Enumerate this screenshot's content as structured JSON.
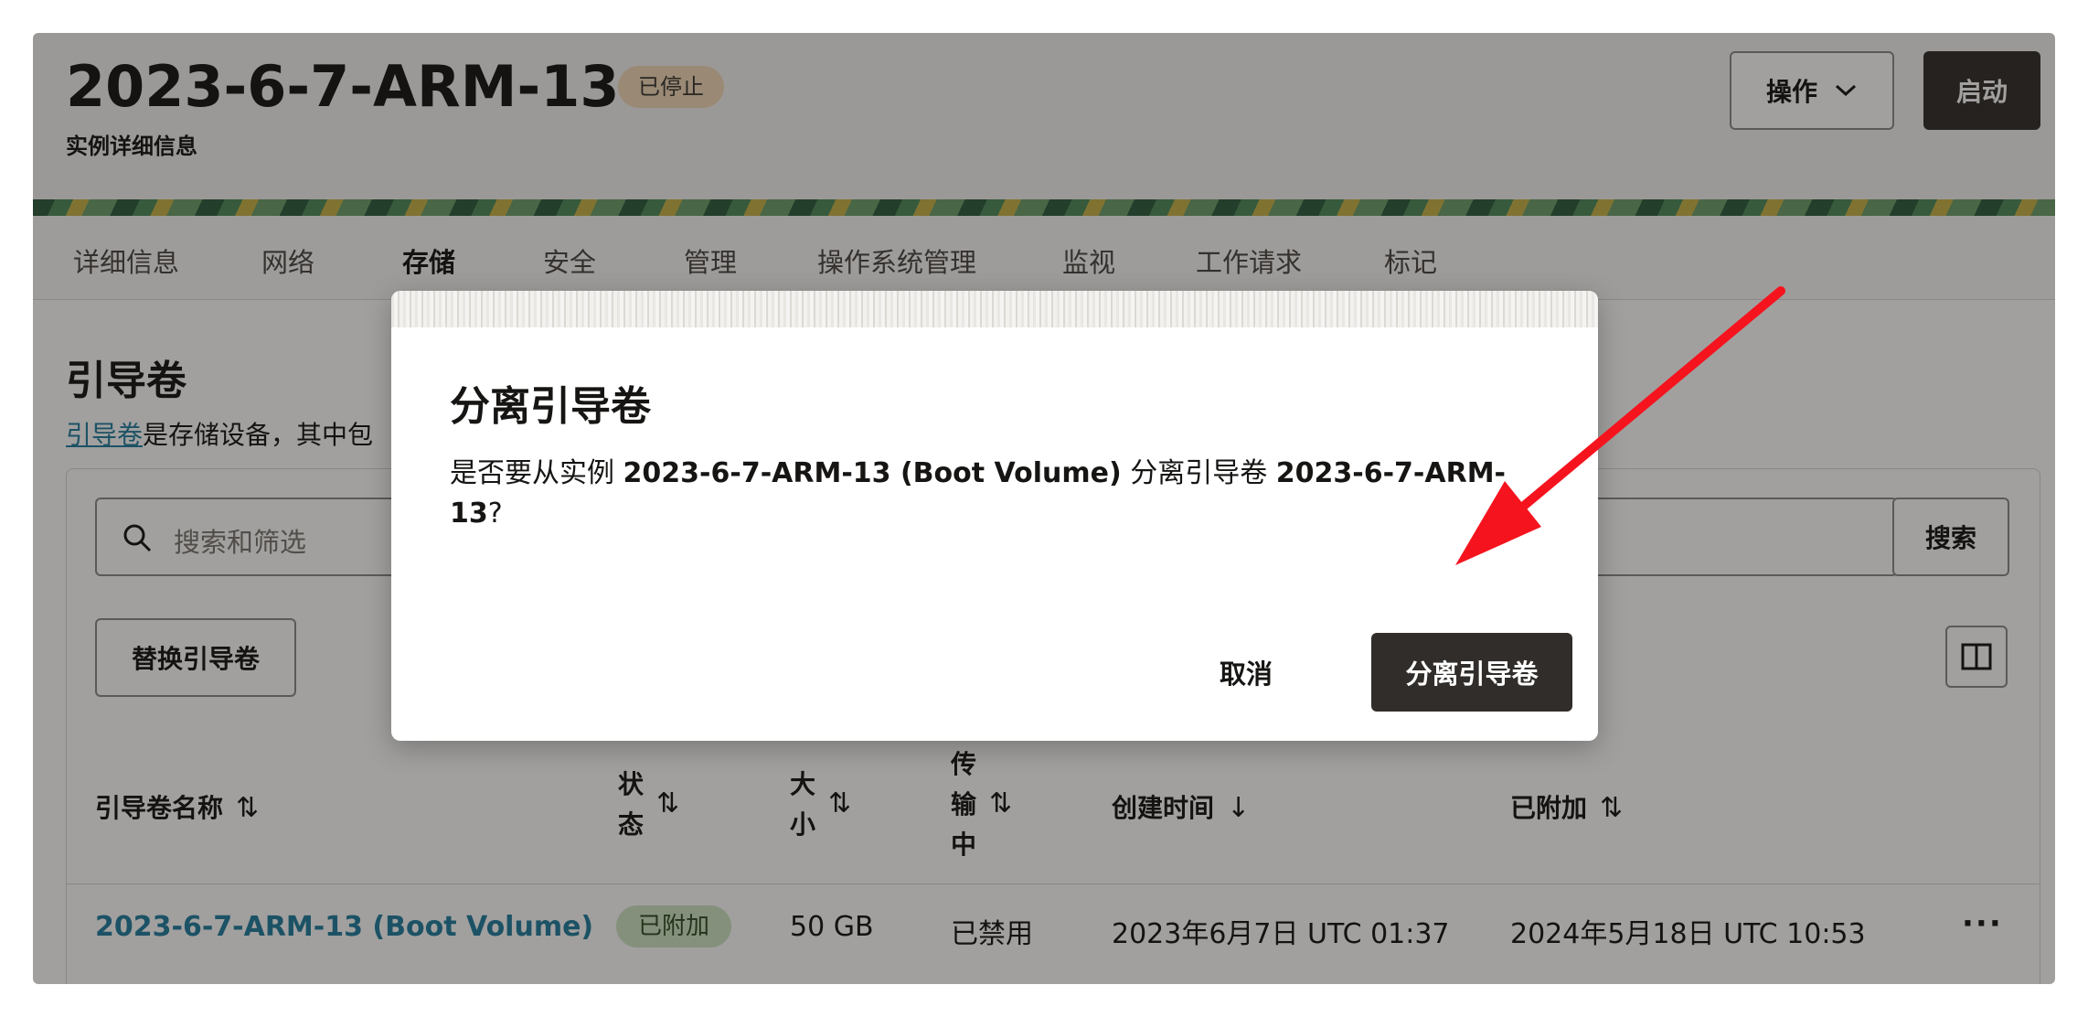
{
  "header": {
    "title": "2023-6-7-ARM-13",
    "status_badge": "已停止",
    "subtitle": "实例详细信息",
    "actions_label": "操作",
    "start_label": "启动"
  },
  "tabs": [
    "详细信息",
    "网络",
    "存储",
    "安全",
    "管理",
    "操作系统管理",
    "监视",
    "工作请求",
    "标记"
  ],
  "active_tab": "存储",
  "section": {
    "title": "引导卷",
    "desc_link": "引导卷",
    "desc_text": "是存储设备，其中包"
  },
  "search": {
    "placeholder": "搜索和筛选",
    "button_label": "搜索"
  },
  "replace_label": "替换引导卷",
  "table": {
    "headers": {
      "name": "引导卷名称",
      "status": [
        "状",
        "态"
      ],
      "size": [
        "大",
        "小"
      ],
      "transfer": [
        "传",
        "输",
        "中"
      ],
      "created": "创建时间",
      "attached": "已附加"
    },
    "sort_icons": {
      "both": "⇅",
      "down": "↓"
    },
    "row": {
      "name": "2023-6-7-ARM-13 (Boot Volume)",
      "status": "已附加",
      "size": "50 GB",
      "transfer": "已禁用",
      "created": "2023年6月7日 UTC 01:37",
      "attached": "2024年5月18日 UTC 10:53",
      "more": "···"
    }
  },
  "dialog": {
    "title": "分离引导卷",
    "body_prefix": "是否要从实例 ",
    "instance": "2023-6-7-ARM-13 (Boot Volume)",
    "body_middle": " 分离引导卷 ",
    "volume": "2023-6-7-ARM-13",
    "body_suffix": "?",
    "cancel_label": "取消",
    "confirm_label": "分离引导卷"
  },
  "colors": {
    "accent_dark": "#312d2a",
    "link": "#227e9e",
    "annotation_arrow": "#f5141e",
    "stopped_badge": "#f2d9b9",
    "attached_badge": "#cfe5c4"
  }
}
